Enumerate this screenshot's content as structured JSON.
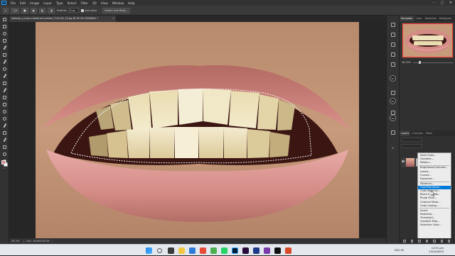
{
  "app": {
    "name": "Photoshop"
  },
  "menubar": {
    "logo": "Ps",
    "items": [
      "File",
      "Edit",
      "Image",
      "Layer",
      "Type",
      "Select",
      "Filter",
      "3D",
      "View",
      "Window",
      "Help"
    ],
    "window_controls": [
      "–",
      "▢",
      "✕"
    ]
  },
  "options": {
    "feather_label": "Feather:",
    "feather_value": "0 px",
    "antialias_label": "Anti-alias",
    "select_mask_label": "Select and Mask..."
  },
  "document": {
    "tab_title": "testeep_a_man-s-teeth-are-yellow_72/1218_13.jpg @ 38.3% (RGB/8#) *",
    "close": "×"
  },
  "status": {
    "zoom": "38.3%",
    "doc_size": "Doc: 38.8M/38.8M",
    "arrow": "›"
  },
  "navigator": {
    "tabs": [
      "Navigator",
      "Color",
      "Swatches",
      "Histogram"
    ],
    "zoom_value": "38.33%"
  },
  "layers": {
    "tabs": [
      "Layers",
      "Channels",
      "Paths"
    ]
  },
  "adjustment_menu": {
    "items": [
      {
        "label": "Solid Color...",
        "group": 1
      },
      {
        "label": "Gradient...",
        "group": 1
      },
      {
        "label": "Pattern...",
        "group": 1
      },
      {
        "label": "Brightness/Contrast...",
        "group": 2
      },
      {
        "label": "Levels...",
        "group": 2
      },
      {
        "label": "Curves...",
        "group": 2
      },
      {
        "label": "Exposure...",
        "group": 2
      },
      {
        "label": "Vibrance...",
        "group": 3
      },
      {
        "label": "Hue/Saturation...",
        "group": 3,
        "highlighted": true
      },
      {
        "label": "Color Balance...",
        "group": 3
      },
      {
        "label": "Black & White...",
        "group": 3
      },
      {
        "label": "Photo Filter...",
        "group": 3
      },
      {
        "label": "Channel Mixer...",
        "group": 3
      },
      {
        "label": "Color Lookup...",
        "group": 3
      },
      {
        "label": "Invert",
        "group": 4
      },
      {
        "label": "Posterize...",
        "group": 4
      },
      {
        "label": "Threshold...",
        "group": 4
      },
      {
        "label": "Gradient Map...",
        "group": 4
      },
      {
        "label": "Selective Color...",
        "group": 4
      }
    ]
  },
  "colors": {
    "foreground": "#d8868f",
    "background": "#ffffff",
    "menu_highlight": "#0078d7",
    "nav_frame": "#ff3b30"
  },
  "taskbar": {
    "time": "12:51 pm",
    "date": "13/10/2023",
    "tray_lang": "ENG",
    "tray_region": "IN"
  }
}
